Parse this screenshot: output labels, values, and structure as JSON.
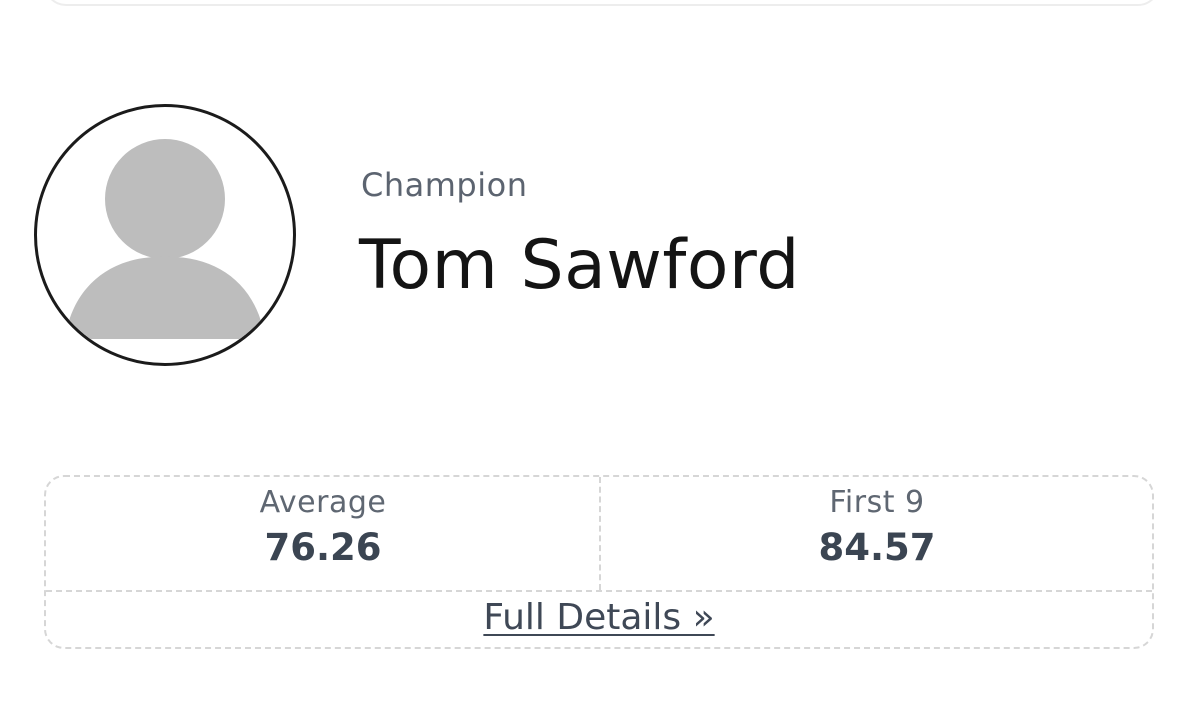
{
  "profile": {
    "role": "Champion",
    "name": "Tom Sawford",
    "avatar_icon": "default-user-avatar-icon"
  },
  "stats": {
    "average_label": "Average",
    "average_value": "76.26",
    "first9_label": "First 9",
    "first9_value": "84.57",
    "details_link": "Full Details »"
  },
  "colors": {
    "avatar_fill": "#bdbdbd",
    "text_dark": "#141414",
    "text_muted": "#5c6470",
    "dashed_border": "#d6d6d6"
  }
}
